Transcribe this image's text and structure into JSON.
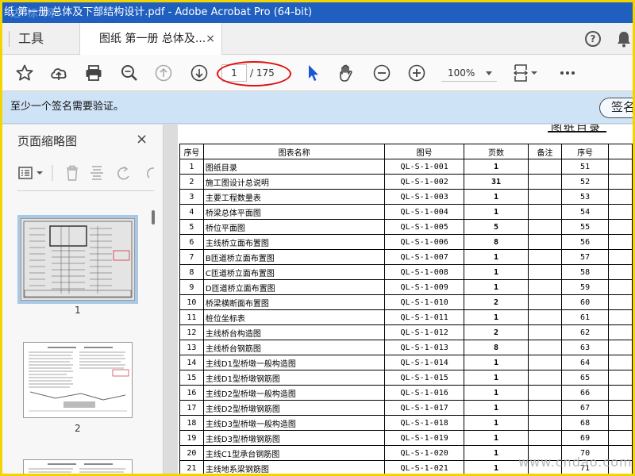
{
  "window": {
    "title": "纸 第一册 总体及下部结构设计.pdf - Adobe Acrobat Pro (64-bit)"
  },
  "tabs": {
    "tools_label": "工具",
    "doc_tab_label": "图纸 第一册 总体及...",
    "close_glyph": "×"
  },
  "toolbar": {
    "page_current": "1",
    "page_total": "/ 175",
    "zoom": "100%",
    "icons": [
      "star-icon",
      "upload-icon",
      "print-icon",
      "zoom-search-icon",
      "page-up-icon",
      "page-down-icon",
      "select-arrow-icon",
      "hand-icon",
      "zoom-out-icon",
      "zoom-in-icon",
      "fit-page-icon",
      "more-icon"
    ]
  },
  "notice": {
    "text": "至少一个签名需要验证。",
    "button": "签名"
  },
  "left_pane": {
    "title": "页面缩略图",
    "close_glyph": "×",
    "thumbnails": [
      "1",
      "2"
    ]
  },
  "document": {
    "header": "图纸目录",
    "columns": [
      "序号",
      "图表名称",
      "图号",
      "页数",
      "备注",
      "序号"
    ],
    "rows": [
      {
        "no": "1",
        "name": "图纸目录",
        "code": "QL-S-1-001",
        "pages": "1",
        "no2": "51"
      },
      {
        "no": "2",
        "name": "施工图设计总说明",
        "code": "QL-S-1-002",
        "pages": "31",
        "no2": "52"
      },
      {
        "no": "3",
        "name": "主要工程数量表",
        "code": "QL-S-1-003",
        "pages": "1",
        "no2": "53"
      },
      {
        "no": "4",
        "name": "桥梁总体平面图",
        "code": "QL-S-1-004",
        "pages": "1",
        "no2": "54"
      },
      {
        "no": "5",
        "name": "桥位平面图",
        "code": "QL-S-1-005",
        "pages": "5",
        "no2": "55"
      },
      {
        "no": "6",
        "name": "主线桥立面布置图",
        "code": "QL-S-1-006",
        "pages": "8",
        "no2": "56"
      },
      {
        "no": "7",
        "name": "B匝道桥立面布置图",
        "code": "QL-S-1-007",
        "pages": "1",
        "no2": "57"
      },
      {
        "no": "8",
        "name": "C匝道桥立面布置图",
        "code": "QL-S-1-008",
        "pages": "1",
        "no2": "58"
      },
      {
        "no": "9",
        "name": "D匝道桥立面布置图",
        "code": "QL-S-1-009",
        "pages": "1",
        "no2": "59"
      },
      {
        "no": "10",
        "name": "桥梁横断面布置图",
        "code": "QL-S-1-010",
        "pages": "2",
        "no2": "60"
      },
      {
        "no": "11",
        "name": "桩位坐标表",
        "code": "QL-S-1-011",
        "pages": "1",
        "no2": "61"
      },
      {
        "no": "12",
        "name": "主线桥台构造图",
        "code": "QL-S-1-012",
        "pages": "2",
        "no2": "62"
      },
      {
        "no": "13",
        "name": "主线桥台钢筋图",
        "code": "QL-S-1-013",
        "pages": "8",
        "no2": "63"
      },
      {
        "no": "14",
        "name": "主线D1型桥墩一般构造图",
        "code": "QL-S-1-014",
        "pages": "1",
        "no2": "64"
      },
      {
        "no": "15",
        "name": "主线D1型桥墩钢筋图",
        "code": "QL-S-1-015",
        "pages": "1",
        "no2": "65"
      },
      {
        "no": "16",
        "name": "主线D2型桥墩一般构造图",
        "code": "QL-S-1-016",
        "pages": "1",
        "no2": "66"
      },
      {
        "no": "17",
        "name": "主线D2型桥墩钢筋图",
        "code": "QL-S-1-017",
        "pages": "1",
        "no2": "67"
      },
      {
        "no": "18",
        "name": "主线D3型桥墩一般构造图",
        "code": "QL-S-1-018",
        "pages": "1",
        "no2": "68"
      },
      {
        "no": "19",
        "name": "主线D3型桥墩钢筋图",
        "code": "QL-S-1-019",
        "pages": "1",
        "no2": "69"
      },
      {
        "no": "20",
        "name": "主线C1型承台钢筋图",
        "code": "QL-S-1-020",
        "pages": "1",
        "no2": "70"
      },
      {
        "no": "21",
        "name": "主线地系梁钢筋图",
        "code": "QL-S-1-021",
        "pages": "1",
        "no2": "71"
      }
    ]
  },
  "watermark": {
    "top": "达 标 网",
    "bottom": "www.cndao.com"
  },
  "colors": {
    "titlebar": "#1f5fbf",
    "frame": "#f2d400",
    "notice_bg": "#cfe3f7",
    "select_arrow": "#1a56d6",
    "highlight_oval": "#e01010"
  }
}
